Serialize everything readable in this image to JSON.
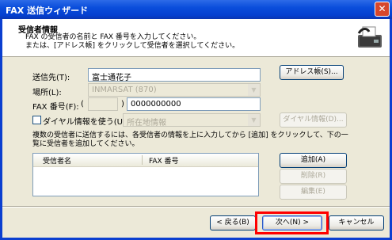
{
  "window": {
    "title": "FAX 送信ウィザード",
    "close_icon": "close-icon"
  },
  "header": {
    "title": "受信者情報",
    "desc_line1": "FAX の受信者の名前と FAX 番号を入力してください。",
    "desc_line2": "または、[アドレス帳] をクリックして受信者を選択してください。",
    "icon": "fax-wizard-icon"
  },
  "form": {
    "to_label": "送信先(T):",
    "to_value": "富士通花子",
    "address_book_button": "アドレス帳(S)...",
    "location_label": "場所(L):",
    "location_value": "INMARSAT (870)",
    "fax_label": "FAX 番号(F):",
    "fax_paren_open": "(",
    "fax_paren_close": ")",
    "fax_area_code": "",
    "fax_number": "0000000000",
    "dialing_rules_label": "ダイヤル情報を使う(U)",
    "dialing_rules_checked": false,
    "dialing_location": "所在地情報",
    "dialing_rules_button": "ダイヤル情報(D)..."
  },
  "recipients": {
    "instructions_line1": "複数の受信者に送信するには、各受信者の情報を上に入力してから [追加] をクリックして、下の一",
    "instructions_line2": "覧に受信者を追加してください。",
    "columns": [
      "受信者名",
      "FAX 番号"
    ],
    "rows": [],
    "add_button": "追加(A)",
    "remove_button": "削除(R)",
    "edit_button": "編集(E)"
  },
  "footer": {
    "back_button": "< 戻る(B)",
    "next_button": "次へ(N) >",
    "cancel_button": "キャンセル",
    "highlight_color": "#ff0000"
  }
}
